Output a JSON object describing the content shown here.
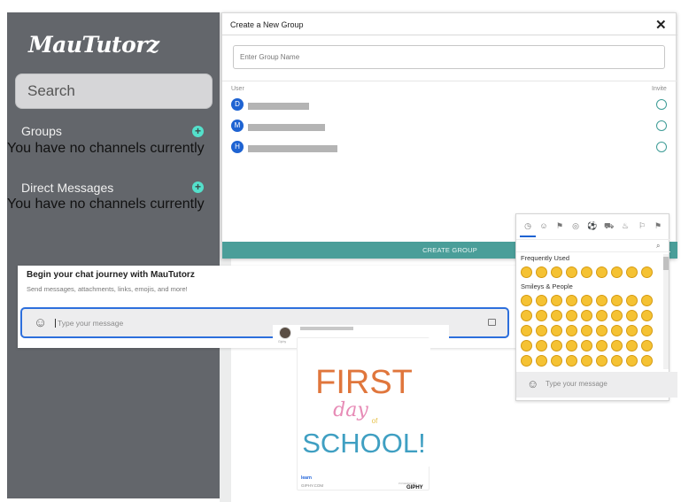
{
  "sidebar": {
    "logo": "MauTutorz",
    "search_placeholder": "Search",
    "groups_label": "Groups",
    "groups_empty": "You have no channels currently",
    "dm_label": "Direct Messages",
    "dm_empty": "You have no channels currently",
    "add_icon": "+"
  },
  "group_dialog": {
    "title": "Create a New Group",
    "close_icon": "✕",
    "name_placeholder": "Enter Group Name",
    "col_user": "User",
    "col_invite": "Invite",
    "users": [
      {
        "initial": "D"
      },
      {
        "initial": "M"
      },
      {
        "initial": "H"
      }
    ],
    "create_button": "CREATE GROUP"
  },
  "chat": {
    "title": "Begin your chat journey with MauTutorz",
    "subtitle": "Send messages, attachments, links, emojis, and more!",
    "message_placeholder": "Type your message",
    "smile_icon": "☺"
  },
  "gif": {
    "giphy_tiny": "Giphy",
    "art_line1": "FIRST",
    "art_line2": "day",
    "art_line3": "of",
    "art_line4": "SCHOOL!",
    "link": "learn",
    "source": "GIPHY.COM",
    "powered": "POWERED BY",
    "brand": "GIPHY"
  },
  "emoji_picker": {
    "frequently_used": "Frequently Used",
    "smileys_people": "Smileys & People",
    "search_icon": "⌕",
    "input_placeholder": "Type your message",
    "category_icons": [
      "◷",
      "☺",
      "⚑",
      "◎",
      "⚽",
      "⛟",
      "♨",
      "⚐",
      "☰",
      "⚑"
    ]
  }
}
